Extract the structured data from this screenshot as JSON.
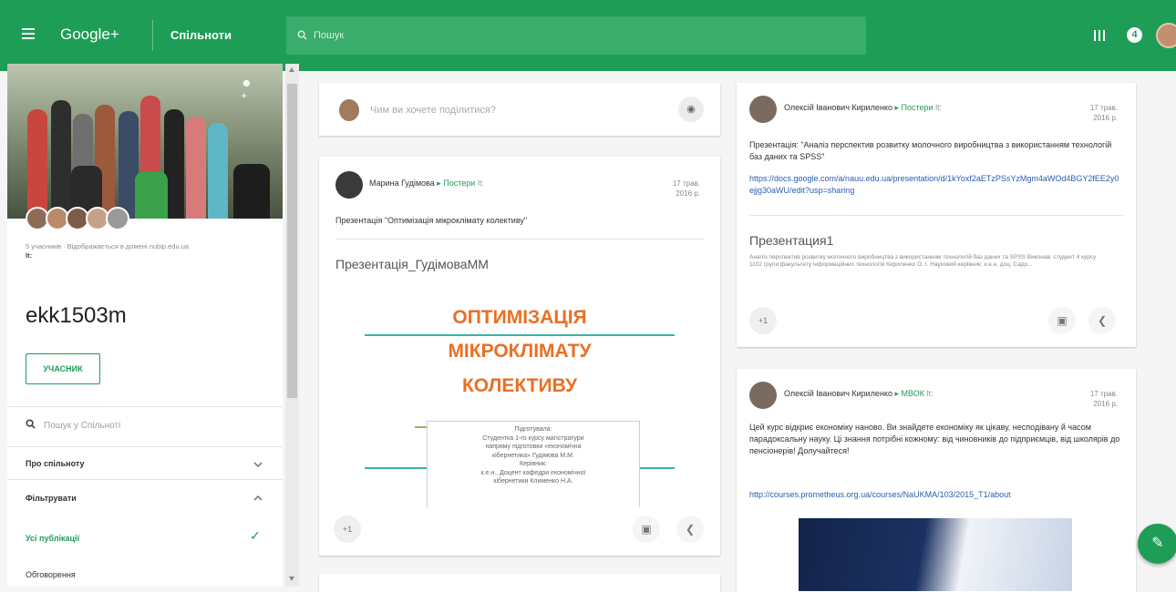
{
  "topbar": {
    "brand": "Google+",
    "section": "Спільноти",
    "search_placeholder": "Пошук",
    "notification_count": "4"
  },
  "community": {
    "members_info": "5 учасників · Відображається в домені nubip.edu.ua",
    "members_visibility": "lt:",
    "name": "ekk1503m",
    "member_button": "УЧАСНИК",
    "search_placeholder": "Пошук у Спільноті",
    "menu": [
      {
        "label": "Про спільноту"
      },
      {
        "label": "Фільтрувати"
      },
      {
        "label": "Усі публікації"
      },
      {
        "label": "Обговорення"
      }
    ]
  },
  "composer": {
    "prompt": "Чим ви хочете поділитися?"
  },
  "posts": [
    {
      "author": "Марина Гудімова",
      "category": "Постери",
      "visibility": "lt:",
      "date_line1": "17 трав.",
      "date_line2": "2016 р.",
      "text": "Презентація \"Оптимізація мікроклімату колективу\"",
      "doc_title": "Презентація_ГудімоваММ",
      "slide": {
        "title_line1": "ОПТИМІЗАЦІЯ",
        "title_line2": "МІКРОКЛІМАТУ",
        "title_line3": "КОЛЕКТИВУ",
        "box": [
          "Підготувала:",
          "Студентка 1-го курсу магістратури",
          "напряму підготовки «економічна",
          "кібернетика» Гудімова М.М.",
          "Керівник:",
          "к.е.н., Доцент кафедри економічної",
          "кібернетики  Клименко Н.А."
        ]
      },
      "plus_one": "+1"
    },
    {
      "author": "Олексій Іванович Кириленко",
      "category": "Постери",
      "visibility": "lt:",
      "date_line1": "17 трав.",
      "date_line2": "2016 р.",
      "text": "Презентація: \"Аналіз перспектив розвитку молочного виробництва з використанням технологій баз даних та SPSS\"",
      "link": "https://docs.google.com/a/nauu.edu.ua/presentation/d/1kYoxf2aETzPSsYzMgm4aWOd4BGY2fEE2y0ejjg30aWU/edit?usp=sharing",
      "doc_title": "Презентация1",
      "doc_desc": "Аналіз перспектив розвитку молочного виробництва з використанням технологій баз даних та SPSS Виконав: студент 4 курсу 1102 групи факультету інформаційних технологій Кириленко О. І. Науковий керівник: к.е.н. доц. Садо...",
      "plus_one": "+1"
    },
    {
      "author": "Олексій Іванович Кириленко",
      "category": "МВОК",
      "visibility": "lt:",
      "date_line1": "17 трав.",
      "date_line2": "2016 р.",
      "text": "Цей курс відкриє економіку наново. Ви знайдете економіку як цікаву, несподівану й часом парадоксальну науку. Ці знання потрібні кожному: від чиновників до підприємців, від школярів до пенсіонерів! Долучайтеся!",
      "link": "http://courses.prometheus.org.ua/courses/NaUKMA/103/2015_T1/about"
    }
  ],
  "colors": {
    "brand_green": "#1e9d57",
    "slide_orange": "#ea6f23",
    "slide_teal": "#3ab3a6",
    "link_blue": "#2a5db0"
  }
}
